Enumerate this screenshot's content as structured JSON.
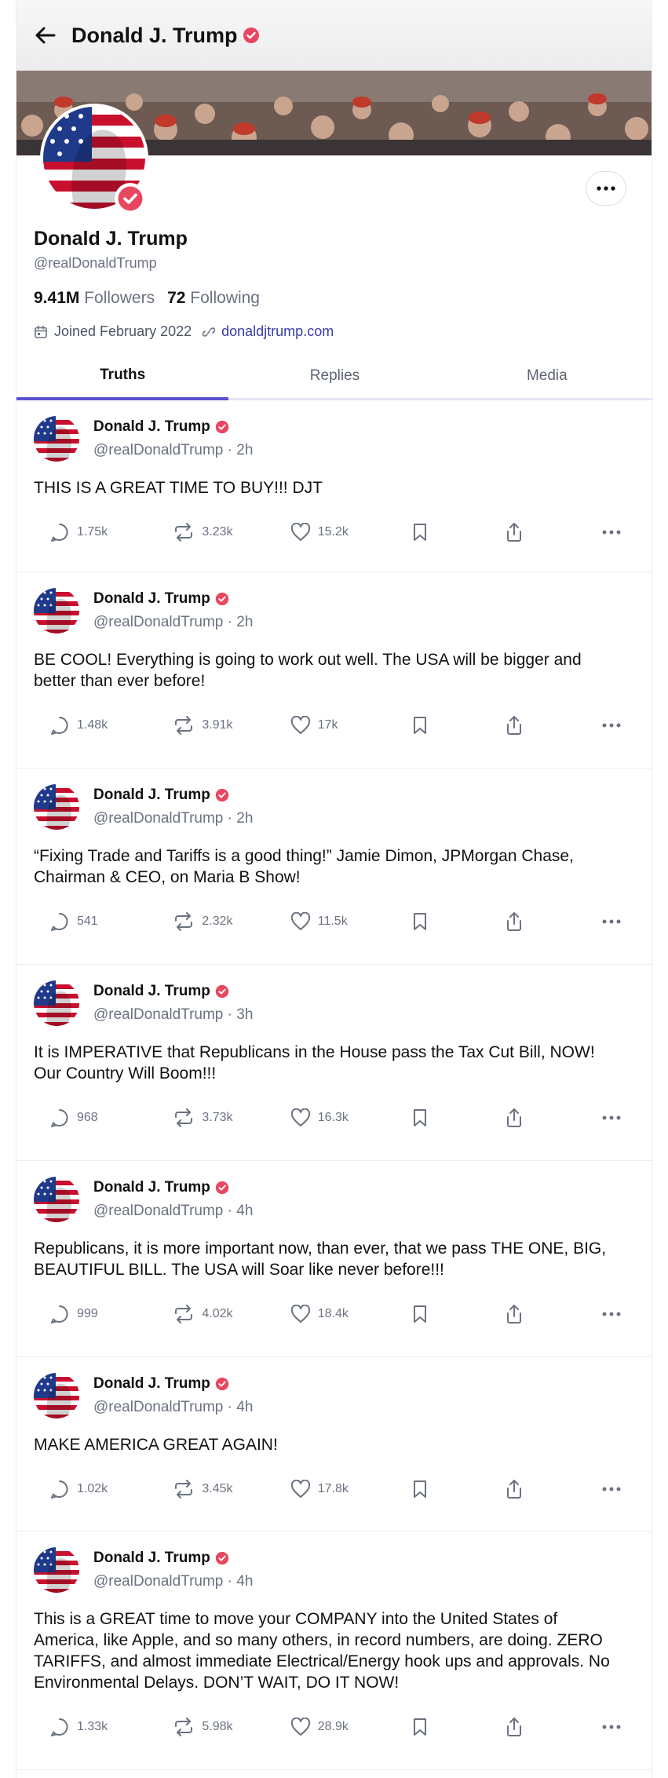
{
  "header": {
    "title": "Donald J. Trump"
  },
  "profile": {
    "name": "Donald J. Trump",
    "handle": "@realDonaldTrump",
    "followers_count": "9.41M",
    "followers_label": "Followers",
    "following_count": "72",
    "following_label": "Following",
    "joined": "Joined February 2022",
    "website": "donaldjtrump.com"
  },
  "tabs": [
    {
      "label": "Truths",
      "active": true
    },
    {
      "label": "Replies",
      "active": false
    },
    {
      "label": "Media",
      "active": false
    }
  ],
  "colors": {
    "accent": "#5a4fcf",
    "verified": "#e8475f",
    "link": "#3b3ba8"
  },
  "icons": [
    "back-arrow-icon",
    "verified-icon",
    "more-icon",
    "calendar-icon",
    "link-icon",
    "reply-icon",
    "repost-icon",
    "like-icon",
    "bookmark-icon",
    "share-icon"
  ],
  "posts": [
    {
      "author": "Donald J. Trump",
      "handle": "@realDonaldTrump",
      "time": "2h",
      "text": "THIS IS A GREAT TIME TO BUY!!! DJT",
      "replies": "1.75k",
      "reposts": "3.23k",
      "likes": "15.2k"
    },
    {
      "author": "Donald J. Trump",
      "handle": "@realDonaldTrump",
      "time": "2h",
      "text": "BE COOL! Everything is going to work out well. The USA will be bigger and better than ever before!",
      "replies": "1.48k",
      "reposts": "3.91k",
      "likes": "17k"
    },
    {
      "author": "Donald J. Trump",
      "handle": "@realDonaldTrump",
      "time": "2h",
      "text": "“Fixing Trade and Tariffs is a good thing!” Jamie Dimon, JPMorgan Chase, Chairman & CEO, on Maria B Show!",
      "replies": "541",
      "reposts": "2.32k",
      "likes": "11.5k"
    },
    {
      "author": "Donald J. Trump",
      "handle": "@realDonaldTrump",
      "time": "3h",
      "text": "It is IMPERATIVE that Republicans in the House pass the Tax Cut Bill, NOW! Our Country Will Boom!!!",
      "replies": "968",
      "reposts": "3.73k",
      "likes": "16.3k"
    },
    {
      "author": "Donald J. Trump",
      "handle": "@realDonaldTrump",
      "time": "4h",
      "text": "Republicans, it is more important now, than ever, that we pass THE ONE, BIG, BEAUTIFUL BILL. The USA will Soar like never before!!!",
      "replies": "999",
      "reposts": "4.02k",
      "likes": "18.4k"
    },
    {
      "author": "Donald J. Trump",
      "handle": "@realDonaldTrump",
      "time": "4h",
      "text": "MAKE AMERICA GREAT AGAIN!",
      "replies": "1.02k",
      "reposts": "3.45k",
      "likes": "17.8k"
    },
    {
      "author": "Donald J. Trump",
      "handle": "@realDonaldTrump",
      "time": "4h",
      "text": "This is a GREAT time to move your COMPANY into the United States of America, like Apple, and so many others, in record numbers, are doing. ZERO TARIFFS, and almost immediate Electrical/Energy hook ups and approvals. No Environmental Delays. DON’T WAIT, DO IT NOW!",
      "replies": "1.33k",
      "reposts": "5.98k",
      "likes": "28.9k"
    }
  ]
}
